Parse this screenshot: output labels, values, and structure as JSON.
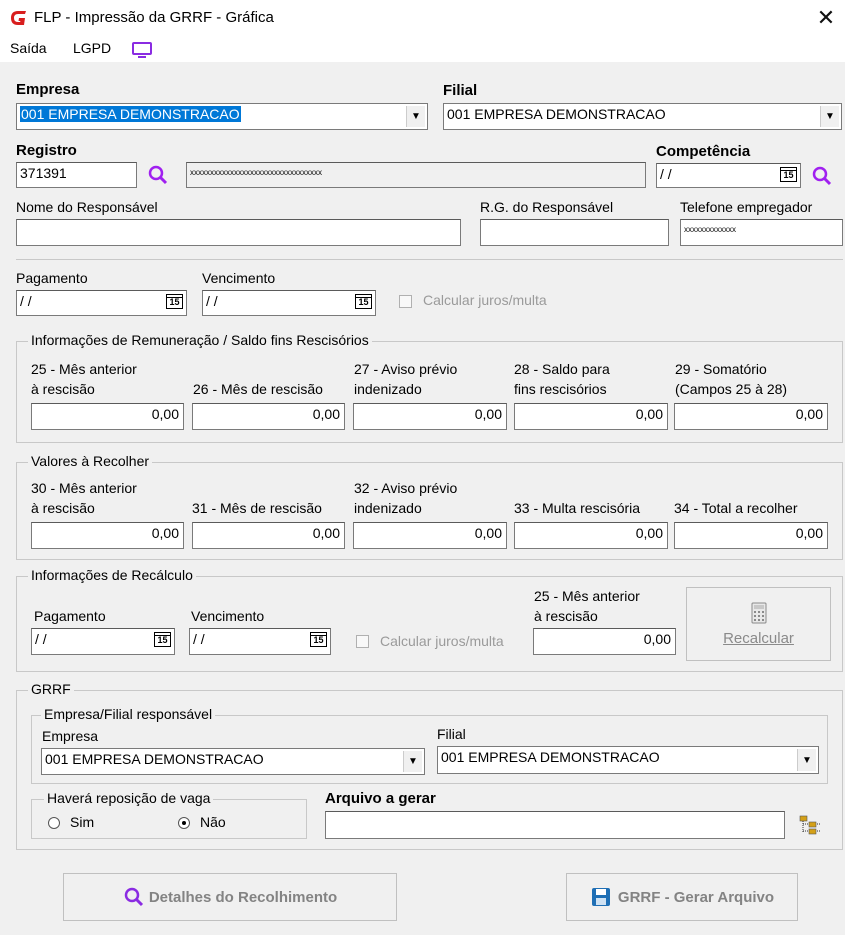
{
  "window": {
    "title": "FLP - Impressão da GRRF - Gráfica",
    "brand_color": "#d81e1e"
  },
  "menu": {
    "saida": "Saída",
    "lgpd": "LGPD"
  },
  "empresa": {
    "label": "Empresa",
    "value": "001 EMPRESA DEMONSTRACAO"
  },
  "filial": {
    "label": "Filial",
    "value": "001 EMPRESA DEMONSTRACAO"
  },
  "registro": {
    "label": "Registro",
    "value": "371391",
    "name_masked": "xxxxxxxxxxxxxxxxxxxxxxxxxxxxxxxxx"
  },
  "competencia": {
    "label": "Competência",
    "value": " / /"
  },
  "responsavel": {
    "nome_label": "Nome do Responsável",
    "nome_value": "",
    "rg_label": "R.G. do Responsável",
    "rg_value": "",
    "tel_label": "Telefone empregador",
    "tel_value": "xxxxxxxxxxxxx"
  },
  "pagamento": {
    "label": "Pagamento",
    "value": " / /"
  },
  "vencimento": {
    "label": "Vencimento",
    "value": " / /"
  },
  "juros": {
    "label": "Calcular juros/multa"
  },
  "remuneracao": {
    "legend": "Informações de Remuneração / Saldo fins Rescisórios",
    "fields": [
      {
        "line1": "25 - Mês anterior",
        "line2": "à rescisão",
        "value": "0,00"
      },
      {
        "line1": "",
        "line2": "26 - Mês de rescisão",
        "value": "0,00"
      },
      {
        "line1": "27 - Aviso prévio",
        "line2": "indenizado",
        "value": "0,00"
      },
      {
        "line1": "28 - Saldo para",
        "line2": "fins rescisórios",
        "value": "0,00"
      },
      {
        "line1": "29 - Somatório",
        "line2": "(Campos 25 à 28)",
        "value": "0,00"
      }
    ]
  },
  "recolher": {
    "legend": "Valores à Recolher",
    "fields": [
      {
        "line1": "30 - Mês anterior",
        "line2": "à rescisão",
        "value": "0,00"
      },
      {
        "line1": "",
        "line2": "31 - Mês de rescisão",
        "value": "0,00"
      },
      {
        "line1": "32 - Aviso prévio",
        "line2": "indenizado",
        "value": "0,00"
      },
      {
        "line1": "",
        "line2": "33 - Multa rescisória",
        "value": "0,00"
      },
      {
        "line1": "",
        "line2": "34 - Total a recolher",
        "value": "0,00"
      }
    ]
  },
  "recalculo": {
    "legend": "Informações de Recálculo",
    "pagamento_label": "Pagamento",
    "pagamento_value": " / /",
    "vencimento_label": "Vencimento",
    "vencimento_value": " / /",
    "juros_label": "Calcular juros/multa",
    "mes_line1": "25 - Mês anterior",
    "mes_line2": "à rescisão",
    "mes_value": "0,00",
    "button": "Recalcular"
  },
  "grrf": {
    "legend": "GRRF",
    "resp_legend": "Empresa/Filial responsável",
    "empresa_label": "Empresa",
    "empresa_value": "001 EMPRESA DEMONSTRACAO",
    "filial_label": "Filial",
    "filial_value": "001 EMPRESA DEMONSTRACAO",
    "vaga_legend": "Haverá reposição de vaga",
    "sim": "Sim",
    "nao": "Não",
    "selected": "Não",
    "arquivo_label": "Arquivo a gerar",
    "arquivo_value": ""
  },
  "buttons": {
    "detalhes": "Detalhes do Recolhimento",
    "gerar": "GRRF - Gerar Arquivo"
  }
}
